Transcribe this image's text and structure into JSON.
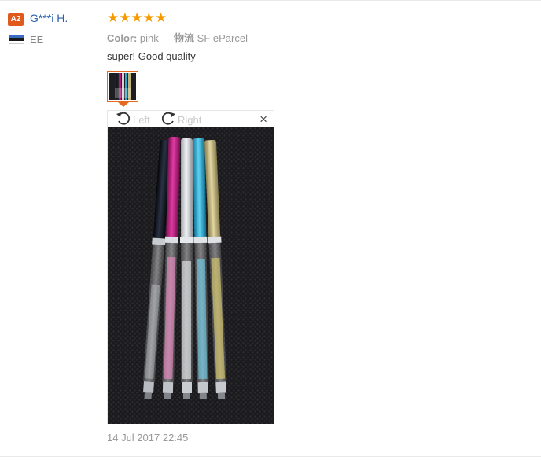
{
  "reviewer": {
    "badge": "A2",
    "name": "G***i H.",
    "country": "EE",
    "flag_colors": [
      "#3b6cc4",
      "#1a1a1a",
      "#ffffff"
    ]
  },
  "review": {
    "rating": 5,
    "stars": "★★★★★",
    "star_color": "#f59b00",
    "color_label": "Color:",
    "color_value": "pink",
    "shipping_label": "物流",
    "shipping_value": "SF eParcel",
    "text": "super! Good quality",
    "date": "14 Jul 2017 22:45"
  },
  "viewer": {
    "rotate_left_label": "Left",
    "rotate_right_label": "Right",
    "close_label": "×",
    "photo_subject": "five stylus pens with crystal-filled barrels",
    "pen_colors": [
      "#13161f",
      "#b4197d",
      "#cfd2d6",
      "#2aa9cf",
      "#bfb27a"
    ],
    "accent": "#e36a1e"
  }
}
